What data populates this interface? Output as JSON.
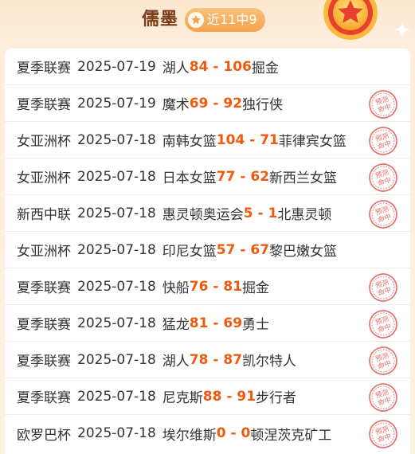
{
  "header": {
    "author": "儒墨",
    "badge_label": "近11中9",
    "colors": {
      "accent": "#f05a0f",
      "badge": "#f1a24f",
      "stamp": "#e3524b"
    }
  },
  "stamp_text": [
    "预测",
    "命中"
  ],
  "matches": [
    {
      "league": "夏季联赛",
      "date": "2025-07-19",
      "home": "湖人",
      "home_score": "84",
      "sep": " - ",
      "away_score": "106",
      "away": "掘金",
      "hit": false
    },
    {
      "league": "夏季联赛",
      "date": "2025-07-19",
      "home": "魔术",
      "home_score": "69",
      "sep": " - ",
      "away_score": "92",
      "away": "独行侠",
      "hit": true
    },
    {
      "league": "女亚洲杯",
      "date": "2025-07-18",
      "home": "南韩女篮",
      "home_score": "104",
      "sep": " - ",
      "away_score": "71",
      "away": "菲律宾女篮",
      "hit": true
    },
    {
      "league": "女亚洲杯",
      "date": "2025-07-18",
      "home": "日本女篮",
      "home_score": "77",
      "sep": " - ",
      "away_score": "62",
      "away": "新西兰女篮",
      "hit": true
    },
    {
      "league": "新西中联",
      "date": "2025-07-18",
      "home": "惠灵顿奥运会",
      "home_score": "5",
      "sep": " - ",
      "away_score": "1",
      "away": "北惠灵顿",
      "hit": true
    },
    {
      "league": "女亚洲杯",
      "date": "2025-07-18",
      "home": "印尼女篮",
      "home_score": "57",
      "sep": " - ",
      "away_score": "67",
      "away": "黎巴嫩女篮",
      "hit": false
    },
    {
      "league": "夏季联赛",
      "date": "2025-07-18",
      "home": "快船",
      "home_score": "76",
      "sep": " - ",
      "away_score": "81",
      "away": "掘金",
      "hit": true
    },
    {
      "league": "夏季联赛",
      "date": "2025-07-18",
      "home": "猛龙",
      "home_score": "81",
      "sep": " - ",
      "away_score": "69",
      "away": "勇士",
      "hit": true
    },
    {
      "league": "夏季联赛",
      "date": "2025-07-18",
      "home": "湖人",
      "home_score": "78",
      "sep": " - ",
      "away_score": "87",
      "away": "凯尔特人",
      "hit": true
    },
    {
      "league": "夏季联赛",
      "date": "2025-07-18",
      "home": "尼克斯",
      "home_score": "88",
      "sep": " - ",
      "away_score": "91",
      "away": "步行者",
      "hit": true
    },
    {
      "league": "欧罗巴杯",
      "date": "2025-07-18",
      "home": "埃尔维斯",
      "home_score": "0",
      "sep": " - ",
      "away_score": "0",
      "away": "顿涅茨克矿工",
      "hit": true
    }
  ]
}
